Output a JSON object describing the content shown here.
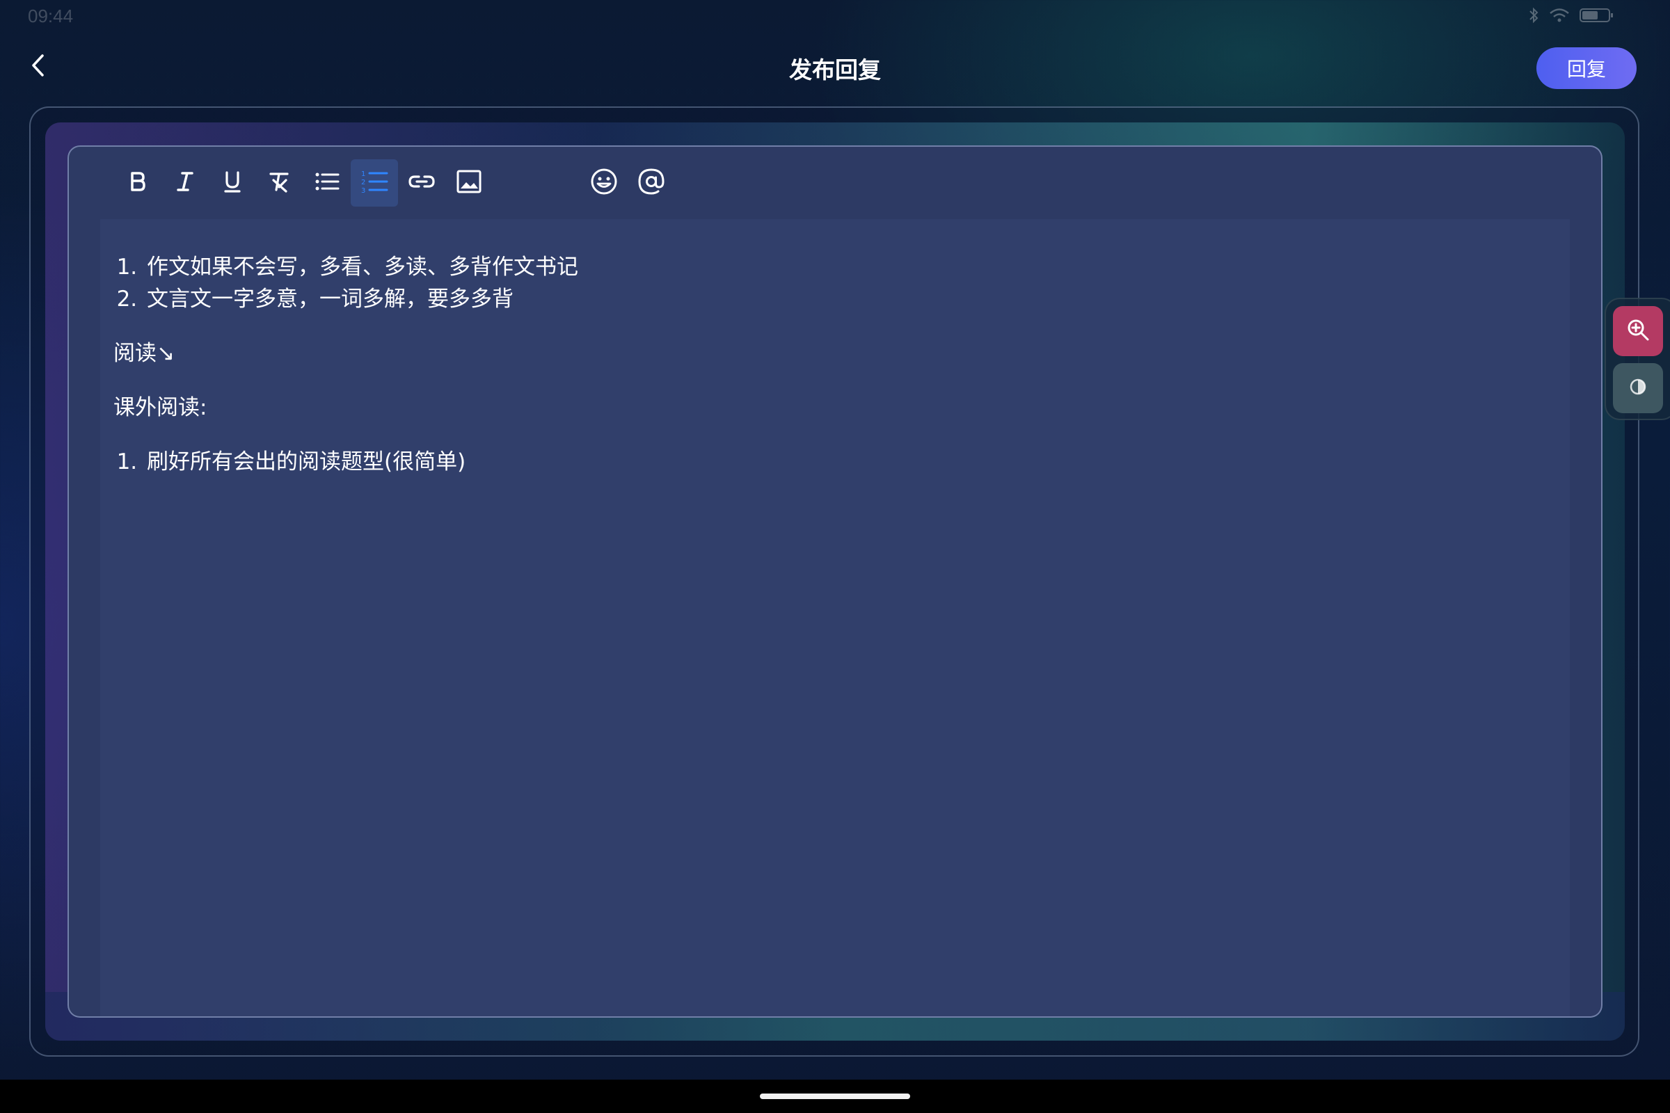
{
  "status_bar": {
    "time": "09:44",
    "icons": [
      "bluetooth-icon",
      "wifi-icon",
      "battery-icon"
    ]
  },
  "header": {
    "title": "发布回复",
    "back_icon": "chevron-left-icon",
    "reply_label": "回复"
  },
  "toolbar": {
    "buttons": [
      {
        "name": "bold",
        "icon": "bold-icon"
      },
      {
        "name": "italic",
        "icon": "italic-icon"
      },
      {
        "name": "underline",
        "icon": "underline-icon"
      },
      {
        "name": "clear-format",
        "icon": "clear-format-icon"
      },
      {
        "name": "bullet-list",
        "icon": "bullet-list-icon"
      },
      {
        "name": "numbered-list",
        "icon": "numbered-list-icon",
        "active": true
      },
      {
        "name": "link",
        "icon": "link-icon"
      },
      {
        "name": "image",
        "icon": "image-icon"
      },
      {
        "name": "emoji",
        "icon": "emoji-icon"
      },
      {
        "name": "mention",
        "icon": "at-icon"
      }
    ]
  },
  "editor": {
    "list1": [
      "作文如果不会写，多看、多读、多背作文书记",
      "文言文一字多意，一词多解，要多多背"
    ],
    "para1": "阅读↘",
    "para2": "课外阅读:",
    "list2": [
      "刷好所有会出的阅读题型(很简单)"
    ]
  },
  "side_tools": {
    "zoom_icon": "zoom-in-icon",
    "contrast_icon": "contrast-icon"
  },
  "colors": {
    "accent": "#5b63f0",
    "editor_bg": "#313f6b",
    "active_tool": "#2f86ff",
    "zoom_button": "#b43a63"
  }
}
